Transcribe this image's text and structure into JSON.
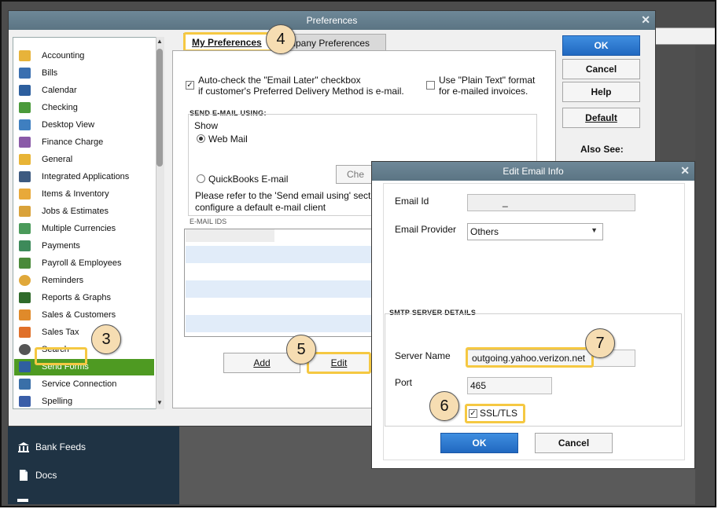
{
  "preferences": {
    "title": "Preferences",
    "categories": [
      "Accounting",
      "Bills",
      "Calendar",
      "Checking",
      "Desktop View",
      "Finance Charge",
      "General",
      "Integrated Applications",
      "Items & Inventory",
      "Jobs & Estimates",
      "Multiple Currencies",
      "Payments",
      "Payroll & Employees",
      "Reminders",
      "Reports & Graphs",
      "Sales & Customers",
      "Sales Tax",
      "Search",
      "Send Forms",
      "Service Connection",
      "Spelling"
    ],
    "selected_category": "Send Forms",
    "tabs": {
      "my": "My Preferences",
      "company": "mpany Preferences"
    },
    "auto_check_line1": "Auto-check the \"Email Later\" checkbox",
    "auto_check_line2": "if customer's Preferred Delivery Method is e-mail.",
    "plain_text_line1": "Use \"Plain Text\" format",
    "plain_text_line2": "for e-mailed invoices.",
    "send_email_heading": "SEND E-MAIL USING:",
    "show_label": "Show",
    "web_mail_label": "Web Mail",
    "quickbooks_email_label": "QuickBooks E-mail",
    "check_button_partial": "Che",
    "refer_line1": "Please refer to the 'Send email using' secti",
    "refer_line2": "configure a default e-mail client",
    "email_ids_heading": "E-MAIL IDS",
    "add_button": "Add",
    "edit_button": "Edit",
    "ok_button": "OK",
    "cancel_button": "Cancel",
    "help_button": "Help",
    "default_button": "Default",
    "also_see": "Also See:"
  },
  "left_nav": [
    {
      "label": "Bank Feeds",
      "icon": "bank-icon"
    },
    {
      "label": "Docs",
      "icon": "document-icon"
    }
  ],
  "dialog": {
    "title": "Edit Email Info",
    "email_id_label": "Email Id",
    "email_id_value": "_",
    "email_provider_label": "Email Provider",
    "email_provider_value": "Others",
    "smtp_heading": "SMTP SERVER DETAILS",
    "server_name_label": "Server Name",
    "server_name_value": "outgoing.yahoo.verizon.net",
    "port_label": "Port",
    "port_value": "465",
    "ssl_label": "SSL/TLS",
    "ok_button": "OK",
    "cancel_button": "Cancel"
  },
  "callouts": [
    "3",
    "4",
    "5",
    "6",
    "7"
  ],
  "colors": {
    "selected_category": "#4e9a22",
    "highlight": "#f5c842",
    "primary_button": "#2168c0",
    "title_bar": "#607d8b",
    "nav_bg": "#1f3344"
  }
}
